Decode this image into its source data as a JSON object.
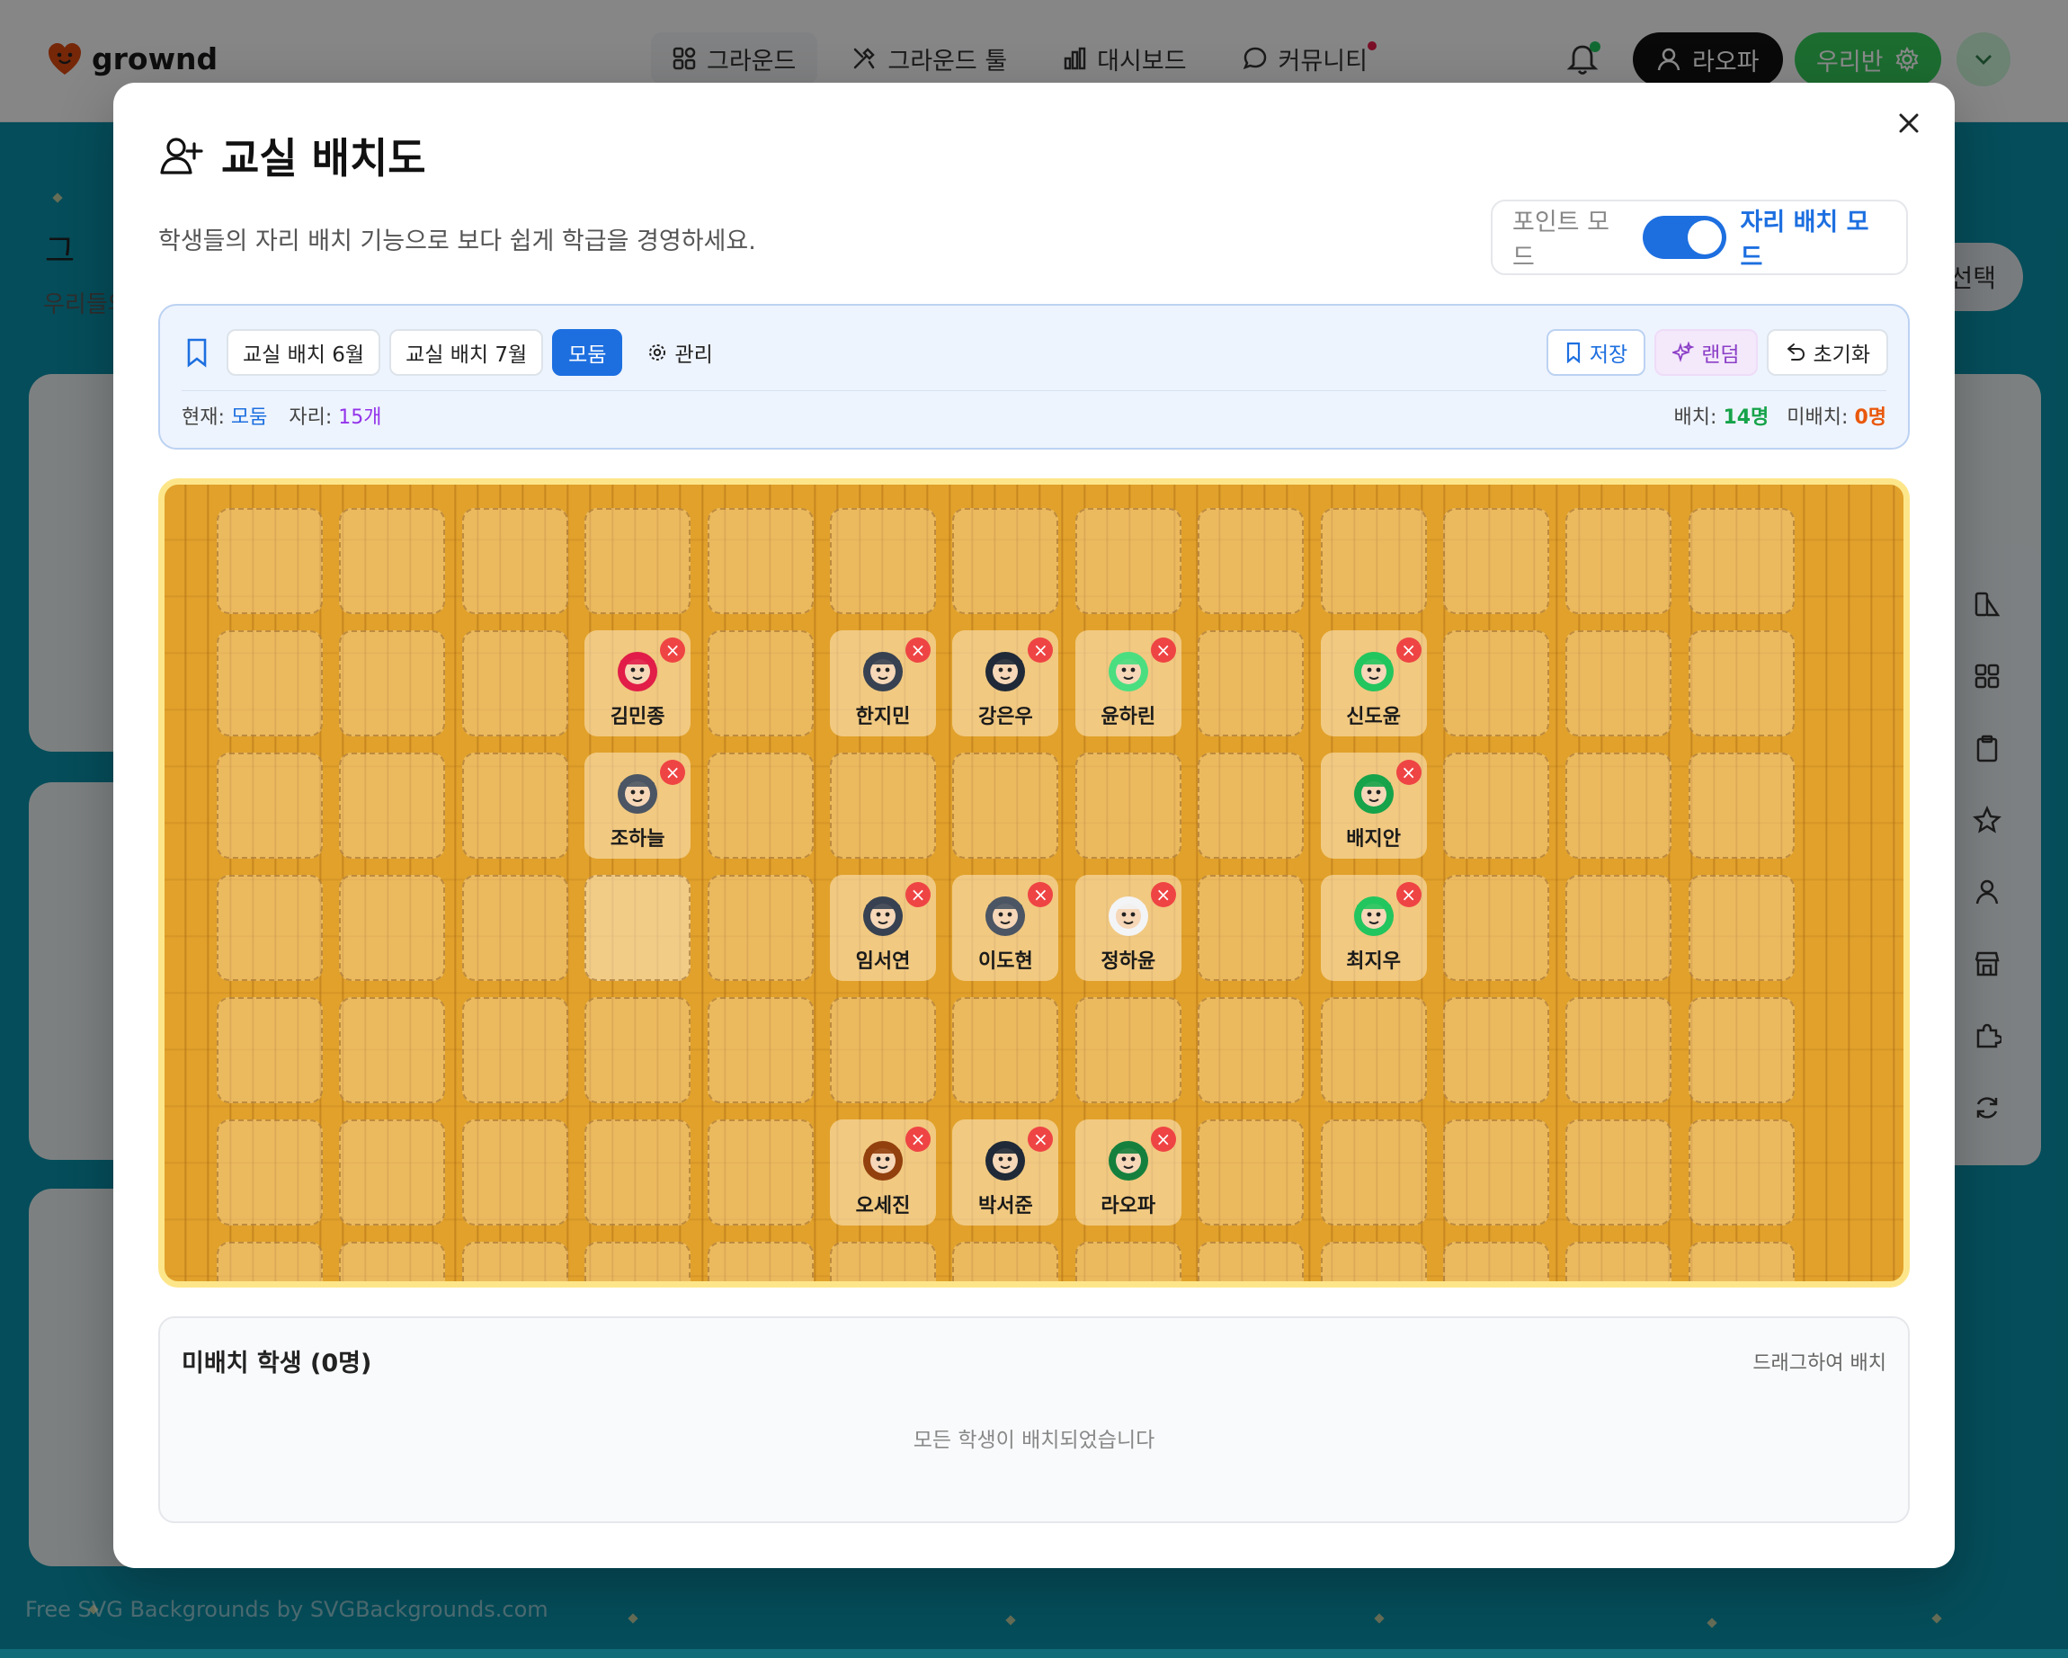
{
  "app": {
    "logo_text": "grownd"
  },
  "nav": {
    "items": [
      {
        "label": "그라운드",
        "icon": "grid-icon",
        "active": true
      },
      {
        "label": "그라운드 툴",
        "icon": "tools-icon",
        "active": false
      },
      {
        "label": "대시보드",
        "icon": "chart-icon",
        "active": false
      },
      {
        "label": "커뮤니티",
        "icon": "chat-icon",
        "active": false,
        "badge": true
      }
    ],
    "user_label": "라오파",
    "class_label": "우리반"
  },
  "background": {
    "page_title": "그",
    "page_sub": "우리들의",
    "select_label": "선택",
    "footer_credit": "Free SVG Backgrounds by SVGBackgrounds.com"
  },
  "modal": {
    "title": "교실 배치도",
    "description": "학생들의 자리 배치 기능으로 보다 쉽게 학급을 경영하세요.",
    "mode_off": "포인트 모드",
    "mode_on": "자리 배치 모드",
    "mode_is_seat": true
  },
  "toolbar": {
    "layouts": [
      "교실 배치 6월",
      "교실 배치 7월",
      "모둠"
    ],
    "active_layout": "모둠",
    "manage_label": "관리",
    "save_label": "저장",
    "random_label": "랜덤",
    "reset_label": "초기화",
    "current_label": "현재:",
    "current_value": "모둠",
    "seats_label": "자리:",
    "seats_value": "15개",
    "placed_label": "배치:",
    "placed_value": "14명",
    "unplaced_label": "미배치:",
    "unplaced_value": "0명"
  },
  "board": {
    "columns": 13,
    "rows": 6,
    "students": [
      {
        "name": "김민종",
        "col": 4,
        "row": 2,
        "avatar": "cowboy-bandit-avatar",
        "color": "#e11d48"
      },
      {
        "name": "한지민",
        "col": 6,
        "row": 2,
        "avatar": "wizard-avatar",
        "color": "#374151"
      },
      {
        "name": "강은우",
        "col": 7,
        "row": 2,
        "avatar": "vampire-avatar",
        "color": "#1f2937"
      },
      {
        "name": "윤하린",
        "col": 8,
        "row": 2,
        "avatar": "green-alien-avatar",
        "color": "#4ade80"
      },
      {
        "name": "신도윤",
        "col": 10,
        "row": 2,
        "avatar": "dragon-avatar",
        "color": "#22c55e"
      },
      {
        "name": "조하늘",
        "col": 4,
        "row": 3,
        "avatar": "robot-avatar",
        "color": "#4b5563"
      },
      {
        "name": "배지안",
        "col": 10,
        "row": 3,
        "avatar": "frankenstein-avatar",
        "color": "#16a34a"
      },
      {
        "name": "임서연",
        "col": 6,
        "row": 4,
        "avatar": "wizard-avatar",
        "color": "#374151"
      },
      {
        "name": "이도현",
        "col": 7,
        "row": 4,
        "avatar": "gargoyle-avatar",
        "color": "#4b5563"
      },
      {
        "name": "정하윤",
        "col": 8,
        "row": 4,
        "avatar": "scientist-avatar",
        "color": "#f3f4f6"
      },
      {
        "name": "최지우",
        "col": 10,
        "row": 4,
        "avatar": "frog-avatar",
        "color": "#22c55e"
      },
      {
        "name": "오세진",
        "col": 6,
        "row": 6,
        "avatar": "eagle-avatar",
        "color": "#92400e"
      },
      {
        "name": "박서준",
        "col": 7,
        "row": 6,
        "avatar": "skull-avatar",
        "color": "#1f2937"
      },
      {
        "name": "라오파",
        "col": 8,
        "row": 6,
        "avatar": "orc-avatar",
        "color": "#15803d"
      }
    ],
    "empty_highlight": {
      "col": 4,
      "row": 4
    }
  },
  "unplaced": {
    "title": "미배치 학생 (0명)",
    "hint": "드래그하여 배치",
    "empty_text": "모든 학생이 배치되었습니다"
  }
}
